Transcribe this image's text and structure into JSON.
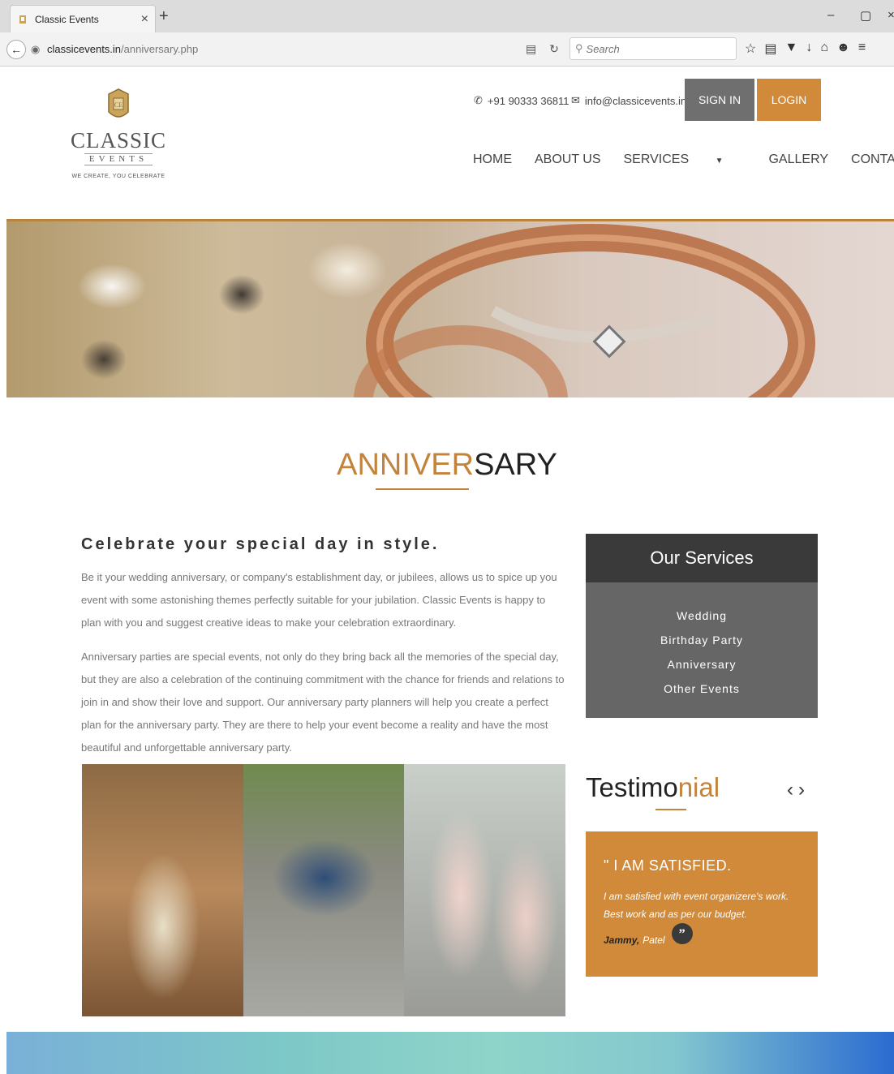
{
  "browser": {
    "tab_title": "Classic Events",
    "tab_close": "×",
    "new_tab": "+",
    "url_domain": "classicevents.in",
    "url_path": "/anniversary.php",
    "search_placeholder": "Search",
    "window_controls": [
      "–",
      "▢",
      "×"
    ]
  },
  "header": {
    "logo_name": "CLASSIC",
    "logo_sub": "EVENTS",
    "logo_tagline": "WE CREATE, YOU CELEBRATE",
    "phone": "+91 90333 36811",
    "email": "info@classicevents.in",
    "signin_label": "SIGN IN",
    "login_label": "LOGIN",
    "nav": [
      "HOME",
      "ABOUT US",
      "SERVICES",
      "GALLERY",
      "CONTACT US"
    ]
  },
  "page": {
    "title_accent": "ANNIVER",
    "title_rest": "SARY",
    "subheading": "Celebrate your special day in style.",
    "para1": "Be it your wedding anniversary, or company's establishment day, or jubilees, allows us to spice up you event with some astonishing themes perfectly suitable for your jubilation. Classic Events is happy to plan with you and suggest creative ideas to make your celebration extraordinary.",
    "para2": "Anniversary parties are special events, not only do they bring back all the memories of the special day, but they are also a celebration of the continuing commitment with the chance for friends and relations to join in and show their love and support. Our anniversary party planners will help you create a perfect plan for the anniversary party. They are there to help your event become a reality and have the most beautiful and unforgettable anniversary party."
  },
  "services": {
    "heading": "Our Services",
    "items": [
      "Wedding",
      "Birthday Party",
      "Anniversary",
      "Other Events"
    ]
  },
  "testimonial": {
    "title_main": "Testimo",
    "title_accent": "nial",
    "quote_head": "\" I AM SATISFIED.",
    "text": "I am satisfied with event organizere's work. Best work and as per our budget.",
    "author_first": "Jammy,",
    "author_last": "Patel"
  },
  "colors": {
    "accent": "#c3833b",
    "login_button": "#d08a3a",
    "signin_button": "#6f6f6f",
    "services_header": "#3a3a3a",
    "services_body": "#666666"
  }
}
